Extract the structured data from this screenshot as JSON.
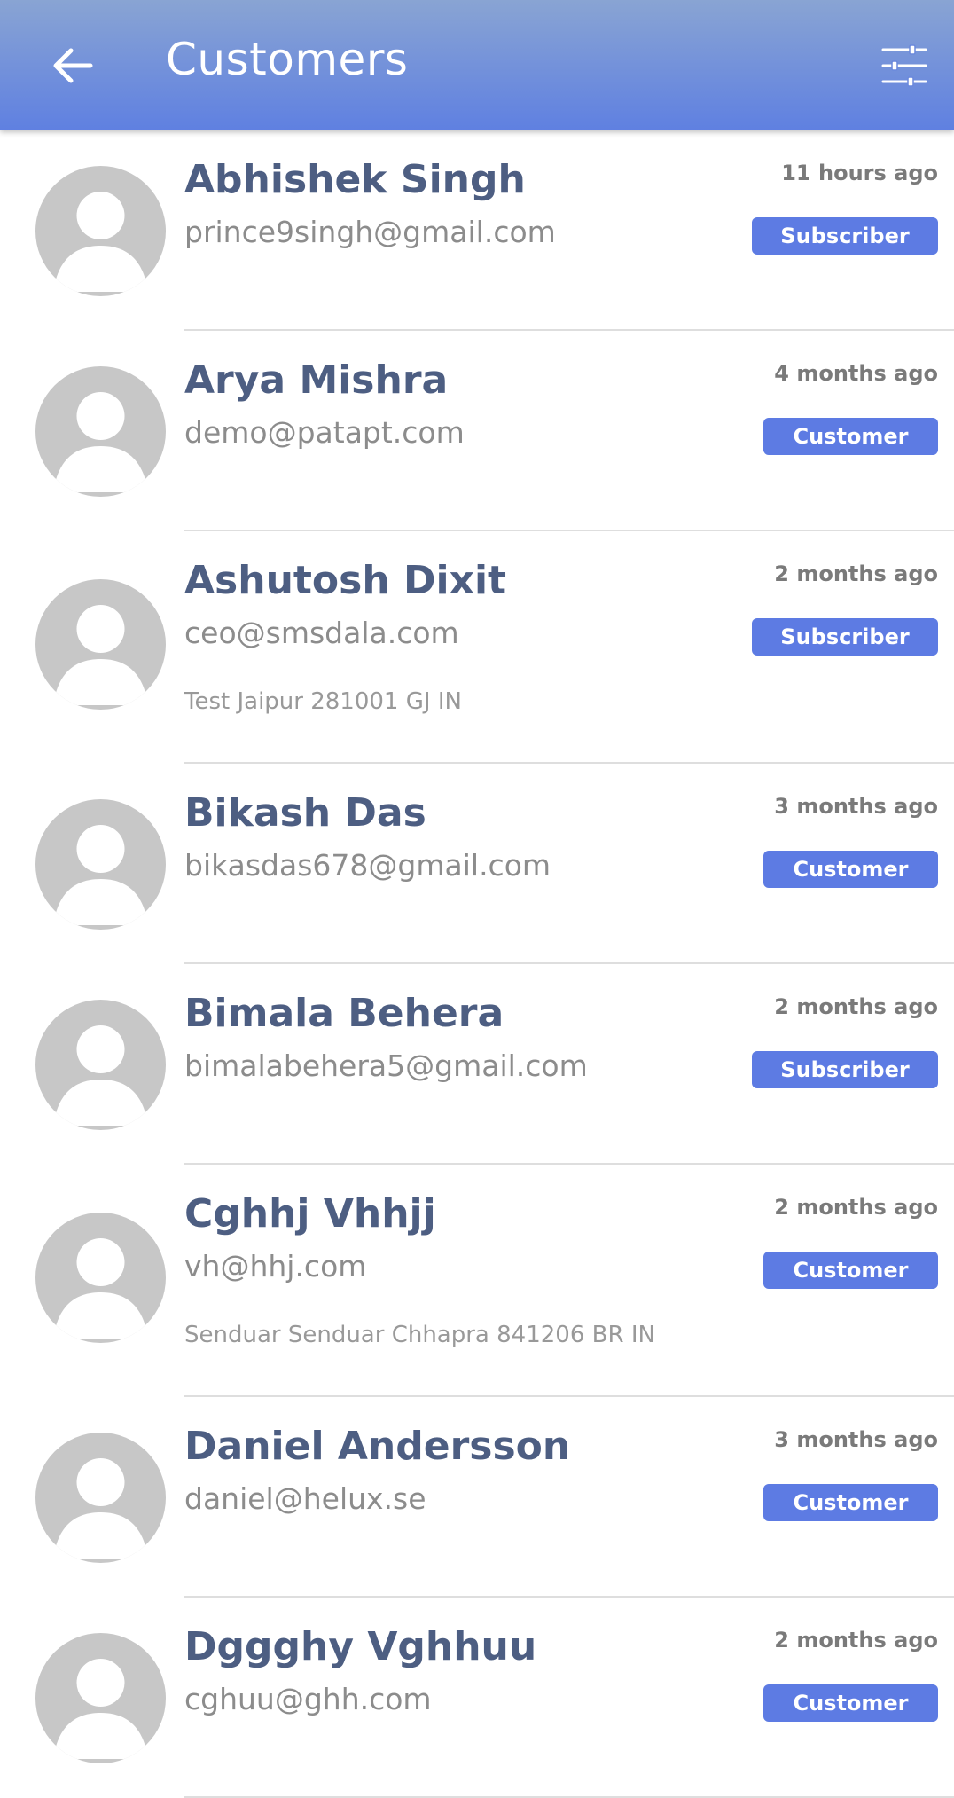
{
  "header": {
    "title": "Customers",
    "back_icon": "arrow-left-icon",
    "filter_icon": "sliders-icon"
  },
  "colors": {
    "appbar_top": "#89a4d3",
    "appbar_bottom": "#5f80e1",
    "badge": "#5d7be3",
    "name": "#4d5e82",
    "email": "#8c8c8c"
  },
  "customers": [
    {
      "name": "Abhishek Singh",
      "email": "prince9singh@gmail.com",
      "time": "11 hours ago",
      "role": "Subscriber",
      "address": ""
    },
    {
      "name": "Arya Mishra",
      "email": "demo@patapt.com",
      "time": "4 months ago",
      "role": "Customer",
      "address": ""
    },
    {
      "name": "Ashutosh Dixit",
      "email": "ceo@smsdala.com",
      "time": "2 months ago",
      "role": "Subscriber",
      "address": "Test Jaipur 281001 GJ IN"
    },
    {
      "name": "Bikash Das",
      "email": "bikasdas678@gmail.com",
      "time": "3 months ago",
      "role": "Customer",
      "address": ""
    },
    {
      "name": "Bimala Behera",
      "email": "bimalabehera5@gmail.com",
      "time": "2 months ago",
      "role": "Subscriber",
      "address": ""
    },
    {
      "name": "Cghhj Vhhjj",
      "email": "vh@hhj.com",
      "time": "2 months ago",
      "role": "Customer",
      "address": "Senduar Senduar Chhapra 841206 BR IN"
    },
    {
      "name": "Daniel Andersson",
      "email": "daniel@helux.se",
      "time": "3 months ago",
      "role": "Customer",
      "address": ""
    },
    {
      "name": "Dggghy Vghhuu",
      "email": "cghuu@ghh.com",
      "time": "2 months ago",
      "role": "Customer",
      "address": ""
    }
  ]
}
